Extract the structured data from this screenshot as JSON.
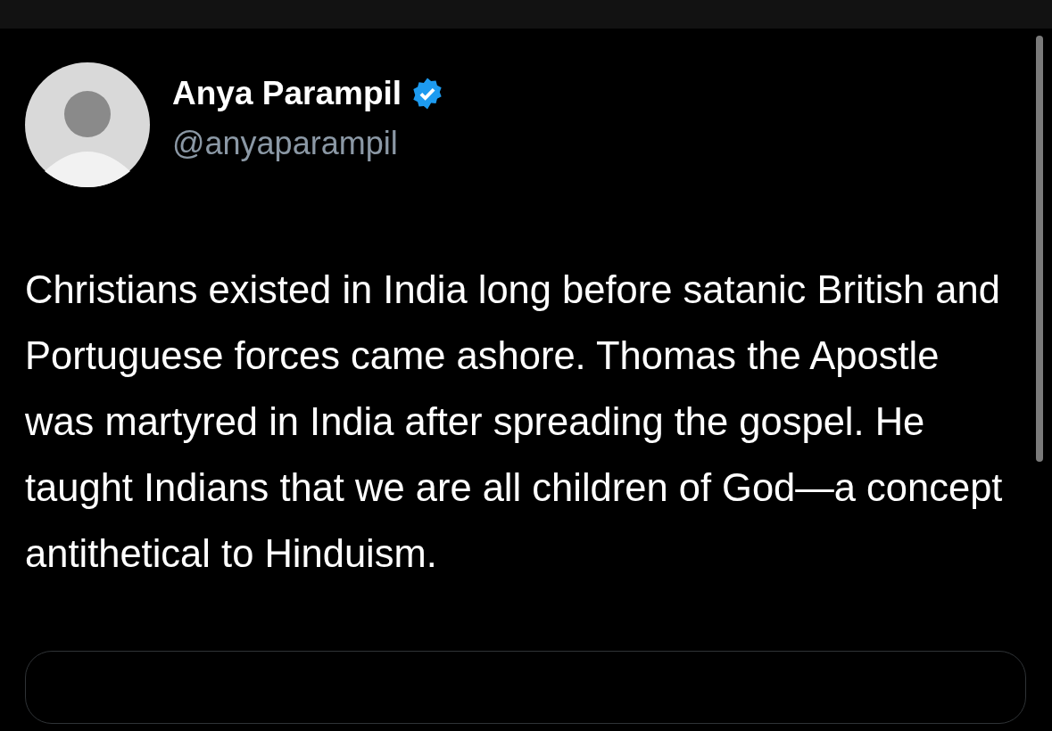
{
  "post": {
    "author": {
      "name": "Anya Parampil",
      "verified": true,
      "handle": "@anyaparampil"
    },
    "text": "Christians existed in India long before satanic British and Portuguese forces came ashore. Thomas the Apostle was martyred in India after spreading the gospel. He taught Indians that we are all children of God—a concept antithetical to Hinduism."
  }
}
